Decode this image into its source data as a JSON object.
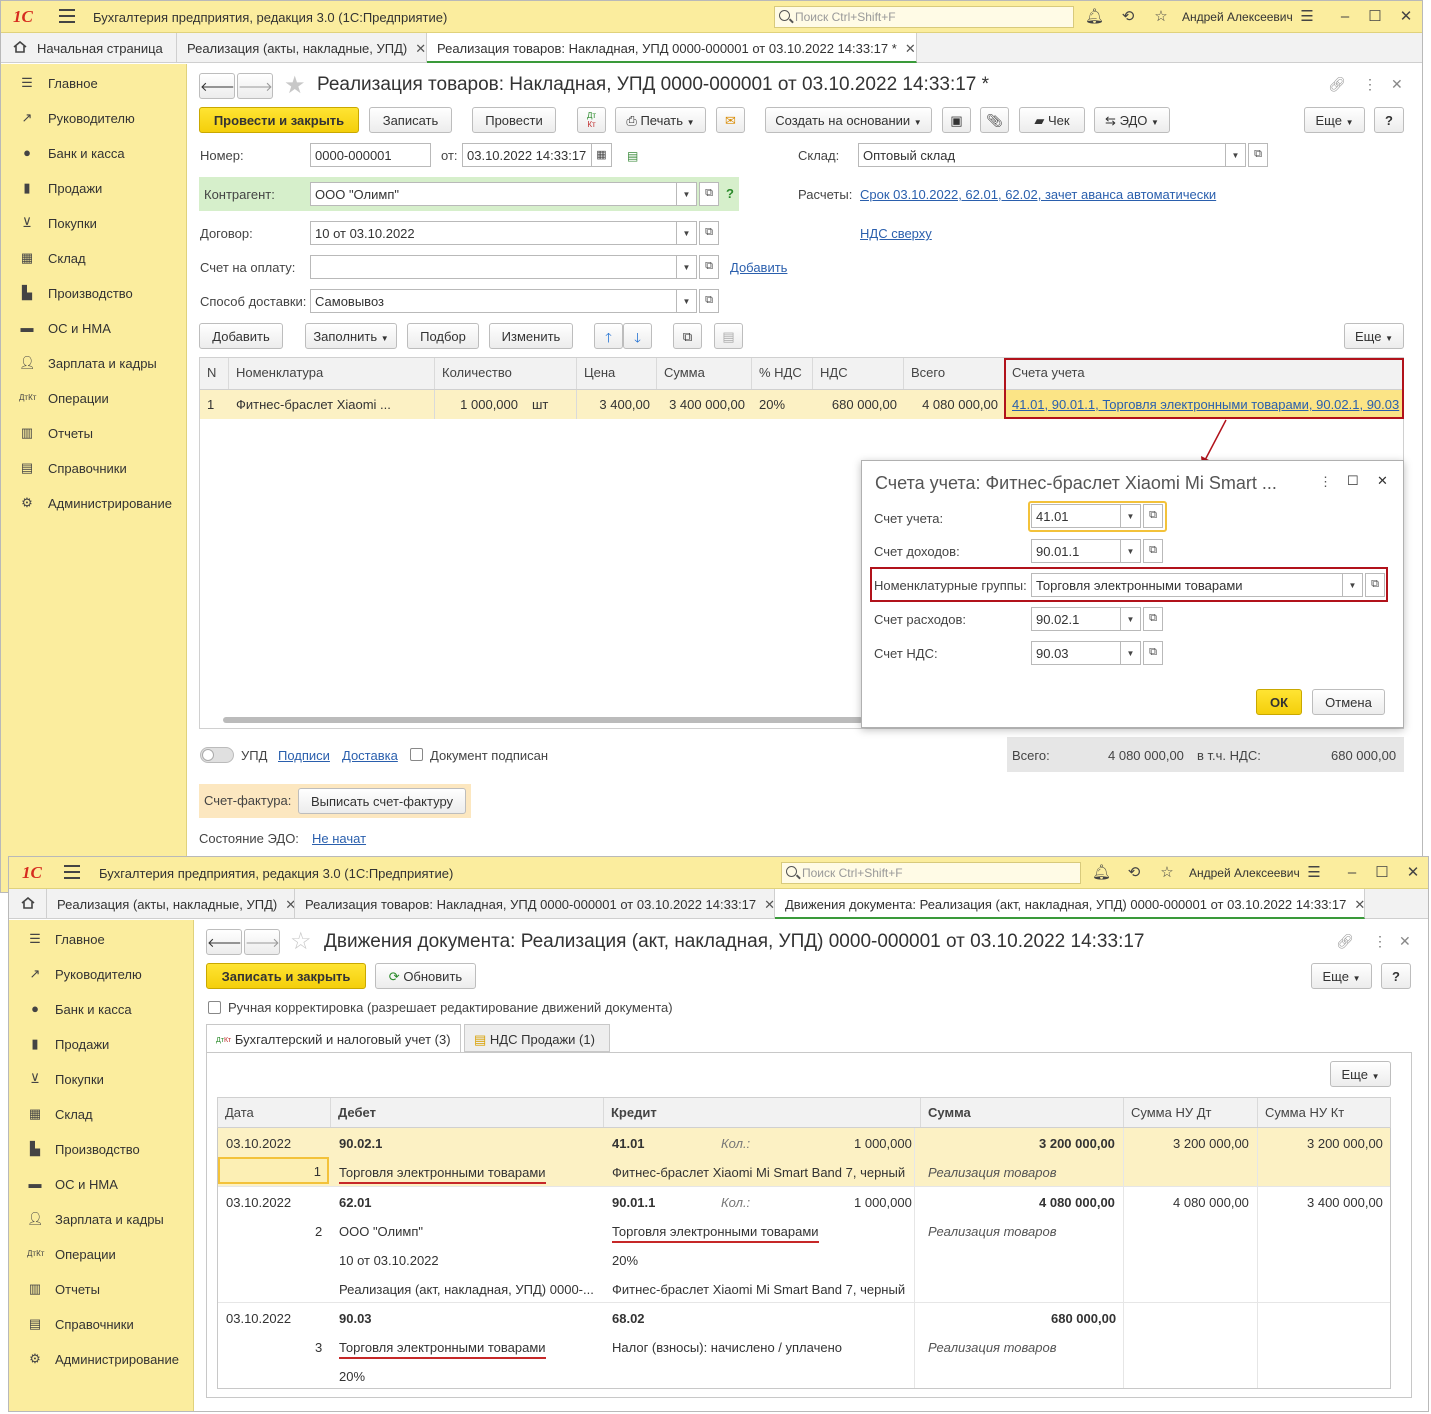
{
  "app": {
    "logo": "1С",
    "title": "Бухгалтерия предприятия, редакция 3.0  (1С:Предприятие)",
    "search_placeholder": "Поиск Ctrl+Shift+F",
    "user": "Андрей Алексеевич"
  },
  "top": {
    "tabs": {
      "home": "Начальная страница",
      "t1": "Реализация (акты, накладные, УПД)",
      "t2": "Реализация товаров: Накладная, УПД 0000-000001 от 03.10.2022 14:33:17 *"
    },
    "sidebar": [
      "Главное",
      "Руководителю",
      "Банк и касса",
      "Продажи",
      "Покупки",
      "Склад",
      "Производство",
      "ОС и НМА",
      "Зарплата и кадры",
      "Операции",
      "Отчеты",
      "Справочники",
      "Администрирование"
    ],
    "doc_title": "Реализация товаров: Накладная, УПД 0000-000001 от 03.10.2022 14:33:17 *",
    "toolbar": {
      "post_close": "Провести и закрыть",
      "save": "Записать",
      "post": "Провести",
      "dtkt": "Дт Кт",
      "print": "Печать",
      "create_based": "Создать на основании",
      "check": "Чек",
      "edo": "ЭДО",
      "more": "Еще",
      "help": "?"
    },
    "form": {
      "number_label": "Номер:",
      "number": "0000-000001",
      "from_label": "от:",
      "date": "03.10.2022 14:33:17",
      "warehouse_label": "Склад:",
      "warehouse": "Оптовый склад",
      "counterparty_label": "Контрагент:",
      "counterparty": "ООО \"Олимп\"",
      "help_q": "?",
      "settlements_label": "Расчеты:",
      "settlements": "Срок 03.10.2022, 62.01, 62.02, зачет аванса автоматически",
      "contract_label": "Договор:",
      "contract": "10 от 03.10.2022",
      "vat_link": "НДС сверху",
      "invoice_label": "Счет на оплату:",
      "invoice": "",
      "add_link": "Добавить",
      "delivery_label": "Способ доставки:",
      "delivery": "Самовывоз"
    },
    "table_toolbar": {
      "add": "Добавить",
      "fill": "Заполнить",
      "select": "Подбор",
      "change": "Изменить",
      "more": "Еще"
    },
    "table": {
      "headers": [
        "N",
        "Номенклатура",
        "Количество",
        "Цена",
        "Сумма",
        "% НДС",
        "НДС",
        "Всего",
        "Счета учета"
      ],
      "row": {
        "n": "1",
        "item": "Фитнес-браслет Xiaomi ...",
        "qty": "1 000,000",
        "unit": "шт",
        "price": "3 400,00",
        "sum": "3 400 000,00",
        "vat_rate": "20%",
        "vat": "680 000,00",
        "total": "4 080 000,00",
        "accounts": "41.01, 90.01.1, Торговля электронными товарами, 90.02.1, 90.03"
      }
    },
    "footer": {
      "upd": "УПД",
      "signatures": "Подписи",
      "delivery": "Доставка",
      "signed": "Документ подписан",
      "total_label": "Всего:",
      "total": "4 080 000,00",
      "vat_label": "в т.ч. НДС:",
      "vat": "680 000,00",
      "sf_label": "Счет-фактура:",
      "sf_button": "Выписать счет-фактуру",
      "edo_label": "Состояние ЭДО:",
      "edo_status": "Не начат"
    },
    "dialog": {
      "title": "Счета учета: Фитнес-браслет Xiaomi Mi Smart ...",
      "account_label": "Счет учета:",
      "account": "41.01",
      "income_label": "Счет доходов:",
      "income": "90.01.1",
      "group_label": "Номенклатурные группы:",
      "group": "Торговля электронными товарами",
      "expense_label": "Счет расходов:",
      "expense": "90.02.1",
      "vat_label": "Счет НДС:",
      "vat": "90.03",
      "ok": "ОК",
      "cancel": "Отмена"
    }
  },
  "bottom": {
    "tabs": {
      "t1": "Реализация (акты, накладные, УПД)",
      "t2": "Реализация товаров: Накладная, УПД 0000-000001 от 03.10.2022 14:33:17",
      "t3": "Движения документа: Реализация (акт, накладная, УПД) 0000-000001 от 03.10.2022 14:33:17"
    },
    "doc_title": "Движения документа: Реализация (акт, накладная, УПД) 0000-000001 от 03.10.2022 14:33:17",
    "toolbar": {
      "save_close": "Записать и закрыть",
      "refresh": "Обновить",
      "more": "Еще",
      "help": "?"
    },
    "manual": "Ручная корректировка (разрешает редактирование движений документа)",
    "subtabs": {
      "acc": "Бухгалтерский и налоговый учет (3)",
      "vat": "НДС Продажи (1)"
    },
    "more": "Еще",
    "headers": [
      "Дата",
      "Дебет",
      "Кредит",
      "Сумма",
      "Сумма НУ Дт",
      "Сумма НУ Кт"
    ],
    "rows": [
      {
        "date": "03.10.2022",
        "n": "1",
        "debit": "90.02.1",
        "debit_sub": [
          "Торговля электронными товарами"
        ],
        "credit": "41.01",
        "kol_label": "Кол.:",
        "kol": "1 000,000",
        "credit_sub": [
          "Фитнес-браслет Xiaomi Mi Smart Band 7, черный"
        ],
        "sum": "3 200 000,00",
        "content": "Реализация товаров",
        "nu_dt": "3 200 000,00",
        "nu_kt": "3 200 000,00"
      },
      {
        "date": "03.10.2022",
        "n": "2",
        "debit": "62.01",
        "debit_sub": [
          "ООО \"Олимп\"",
          "10 от 03.10.2022",
          "Реализация (акт, накладная, УПД) 0000-..."
        ],
        "credit": "90.01.1",
        "kol_label": "Кол.:",
        "kol": "1 000,000",
        "credit_sub": [
          "Торговля электронными товарами",
          "20%",
          "Фитнес-браслет Xiaomi Mi Smart Band 7, черный"
        ],
        "sum": "4 080 000,00",
        "content": "Реализация товаров",
        "nu_dt": "4 080 000,00",
        "nu_kt": "3 400 000,00"
      },
      {
        "date": "03.10.2022",
        "n": "3",
        "debit": "90.03",
        "debit_sub": [
          "Торговля электронными товарами",
          "20%"
        ],
        "credit": "68.02",
        "credit_sub": [
          "Налог (взносы): начислено / уплачено"
        ],
        "sum": "680 000,00",
        "content": "Реализация товаров"
      }
    ]
  },
  "colors": {
    "accent_yellow": "#fbed9e",
    "button_yellow": "#f4cf0b",
    "highlight_red": "#b1121b",
    "link": "#2a5fad"
  }
}
